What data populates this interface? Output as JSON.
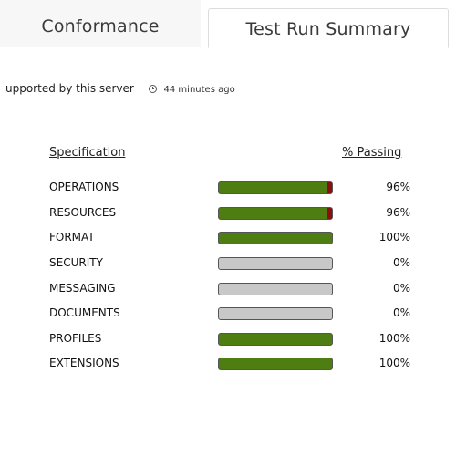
{
  "tabs": [
    {
      "label": "Conformance"
    },
    {
      "label": "Test Run Summary"
    }
  ],
  "status": {
    "text": "upported by this server",
    "icon": "clock-icon",
    "time_ago": "44 minutes ago"
  },
  "table": {
    "header_spec": "Specification",
    "header_passing": "% Passing",
    "rows": [
      {
        "name": "OPERATIONS",
        "percent_label": "96%",
        "pass_fraction": 0.96
      },
      {
        "name": "RESOURCES",
        "percent_label": "96%",
        "pass_fraction": 0.96
      },
      {
        "name": "FORMAT",
        "percent_label": "100%",
        "pass_fraction": 1.0
      },
      {
        "name": "SECURITY",
        "percent_label": "0%",
        "pass_fraction": 0
      },
      {
        "name": "MESSAGING",
        "percent_label": "0%",
        "pass_fraction": 0
      },
      {
        "name": "DOCUMENTS",
        "percent_label": "0%",
        "pass_fraction": 0
      },
      {
        "name": "PROFILES",
        "percent_label": "100%",
        "pass_fraction": 1.0
      },
      {
        "name": "EXTENSIONS",
        "percent_label": "100%",
        "pass_fraction": 1.0
      }
    ]
  },
  "colors": {
    "pass": "#4e7d12",
    "fail": "#8b0f0f",
    "empty": "#c8c8c8"
  }
}
